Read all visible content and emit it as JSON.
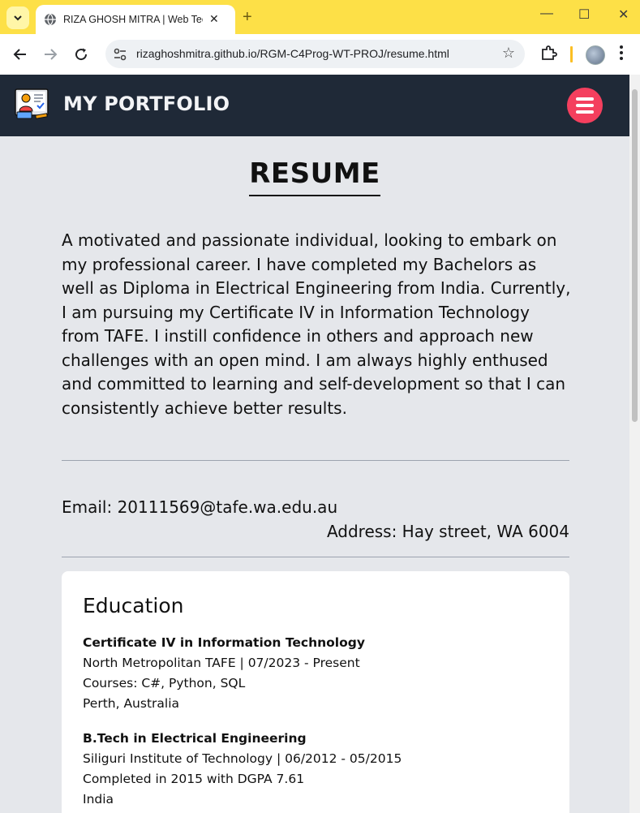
{
  "browser": {
    "tab_title": "RIZA GHOSH MITRA | Web Technologies",
    "url": "rizaghoshmitra.github.io/RGM-C4Prog-WT-PROJ/resume.html",
    "new_tab_symbol": "+",
    "controls": {
      "minimize": "—",
      "maximize": "☐",
      "close": "✕"
    }
  },
  "site": {
    "title": "MY PORTFOLIO",
    "accent_color": "#f43f5e",
    "header_color": "#1f2937"
  },
  "resume": {
    "heading": "RESUME",
    "intro": "A motivated and passionate individual, looking to embark on my professional career. I have completed my Bachelors as well as Diploma in Electrical Engineering from India. Currently, I am pursuing my Certificate IV in Information Technology from TAFE. I instill confidence in others and approach new challenges with an open mind. I am always highly enthused and committed to learning and self-development so that I can consistently achieve better results.",
    "email": "Email: 20111569@tafe.wa.edu.au",
    "address": "Address: Hay street, WA 6004"
  },
  "education": {
    "heading": "Education",
    "items": [
      {
        "degree": "Certificate IV in Information Technology",
        "line1": "North Metropolitan TAFE | 07/2023 - Present",
        "line2": "Courses: C#, Python, SQL",
        "line3": "Perth, Australia"
      },
      {
        "degree": "B.Tech in Electrical Engineering",
        "line1": "Siliguri Institute of Technology | 06/2012 - 05/2015",
        "line2": "Completed in 2015 with DGPA 7.61",
        "line3": "India"
      }
    ]
  }
}
